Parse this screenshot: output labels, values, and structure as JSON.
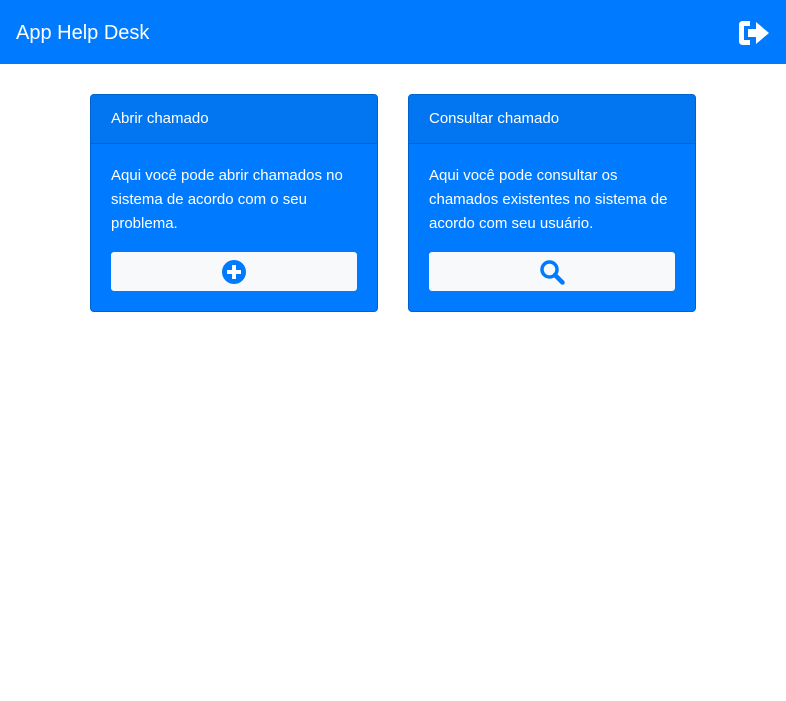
{
  "navbar": {
    "brand": "App Help Desk",
    "logout_icon": "sign-out-icon",
    "background_color": "#007bff"
  },
  "cards": [
    {
      "title": "Abrir chamado",
      "text": "Aqui você pode abrir chamados no sistema de acordo com o seu problema.",
      "button_icon": "plus-circle-icon"
    },
    {
      "title": "Consultar chamado",
      "text": "Aqui você pode consultar os chamados existentes no sistema de acordo com seu usuário.",
      "button_icon": "search-icon"
    }
  ],
  "colors": {
    "primary": "#007bff",
    "button_background": "#f8f9fa"
  }
}
